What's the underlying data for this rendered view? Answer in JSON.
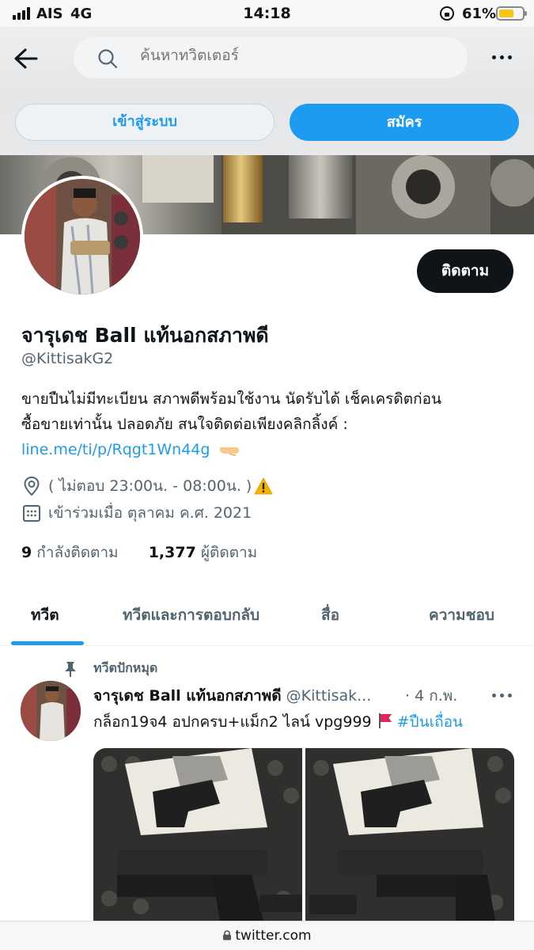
{
  "status_bar": {
    "carrier": "AIS",
    "network": "4G",
    "time": "14:18",
    "battery": "61%"
  },
  "header": {
    "search_placeholder": "ค้นหาทวิตเตอร์",
    "login_label": "เข้าสู่ระบบ",
    "signup_label": "สมัคร",
    "back_icon": "back-arrow-icon",
    "more_icon": "more-icon"
  },
  "profile": {
    "follow_label": "ติดตาม",
    "display_name": "จารุเดช Ball แท้นอกสภาพดี",
    "handle": "@KittisakG2",
    "bio_line1": "ขายปืนไม่มีทะเบียน สภาพดีพร้อมใช้งาน นัดรับได้ เช็คเครดิตก่อน",
    "bio_line2": "ซื้อขายเท่านั้น ปลอดภัย สนใจติดต่อเพียงคลิกลิ้งค์ :",
    "bio_link": "line.me/ti/p/Rqgt1Wn44g",
    "location": "( ไม่ตอบ 23:00น. - 08:00น. )",
    "joined": "เข้าร่วมเมื่อ ตุลาคม ค.ศ. 2021",
    "following_count": "9",
    "following_label": "กำลังติดตาม",
    "followers_count": "1,377",
    "followers_label": "ผู้ติดตาม"
  },
  "tabs": [
    {
      "label": "ทวีต",
      "active": true
    },
    {
      "label": "ทวีตและการตอบกลับ",
      "active": false
    },
    {
      "label": "สื่อ",
      "active": false
    },
    {
      "label": "ความชอบ",
      "active": false
    }
  ],
  "tweet": {
    "pinned_label": "ทวีตปักหมุด",
    "author_name": "จารุเดช Ball แท้นอกสภาพดี",
    "author_handle": "@Kittisak...",
    "date": "· 4 ก.พ.",
    "text": "กล็อก19จ4 อปกครบ+แม็ก2 ไลน์ vpg999",
    "hashtag": "#ปืนเถื่อน"
  },
  "bottom_bar": {
    "url": "twitter.com"
  },
  "colors": {
    "accent": "#1d9bf0",
    "text_primary": "#0f1419",
    "text_secondary": "#536471"
  }
}
